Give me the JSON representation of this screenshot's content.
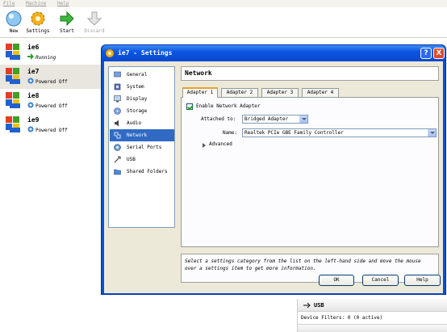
{
  "menubar": {
    "items": [
      "File",
      "Machine",
      "Help"
    ]
  },
  "toolbar": {
    "new_label": "New",
    "settings_label": "Settings",
    "start_label": "Start",
    "discard_label": "Discard"
  },
  "vms": [
    {
      "name": "ie6",
      "state": "Running"
    },
    {
      "name": "ie7",
      "state": "Powered Off"
    },
    {
      "name": "ie8",
      "state": "Powered Off"
    },
    {
      "name": "ie9",
      "state": "Powered Off"
    }
  ],
  "details": {
    "usb_title": "USB",
    "usb_line": "Device Filters: 0 (0 active)"
  },
  "dialog": {
    "title": "ie7 - Settings",
    "help_glyph": "?",
    "close_glyph": "X",
    "categories": [
      "General",
      "System",
      "Display",
      "Storage",
      "Audio",
      "Network",
      "Serial Ports",
      "USB",
      "Shared Folders"
    ],
    "selected_category": "Network",
    "page_title": "Network",
    "tabs": [
      "Adapter 1",
      "Adapter 2",
      "Adapter 3",
      "Adapter 4"
    ],
    "enable_label": "Enable Network Adapter",
    "attached_label": "Attached to:",
    "attached_value": "Bridged Adapter",
    "name_label": "Name:",
    "name_value": "Realtek PCIe GBE Family Controller",
    "advanced_label": "Advanced",
    "info_text": "Select a settings category from the list on the left-hand side and move the mouse over a settings item to get more information.",
    "ok_label": "OK",
    "cancel_label": "Cancel",
    "help_label": "Help"
  },
  "colors": {
    "title_blue": "#0a4fd8",
    "selection_blue": "#316ac5",
    "dialog_face": "#ece9d8"
  },
  "icons": [
    "new-icon",
    "settings-gear-icon",
    "start-arrow-icon",
    "discard-arrow-icon",
    "windows-xp-logo-icon",
    "running-arrow-icon",
    "powered-off-icon",
    "usb-icon"
  ]
}
